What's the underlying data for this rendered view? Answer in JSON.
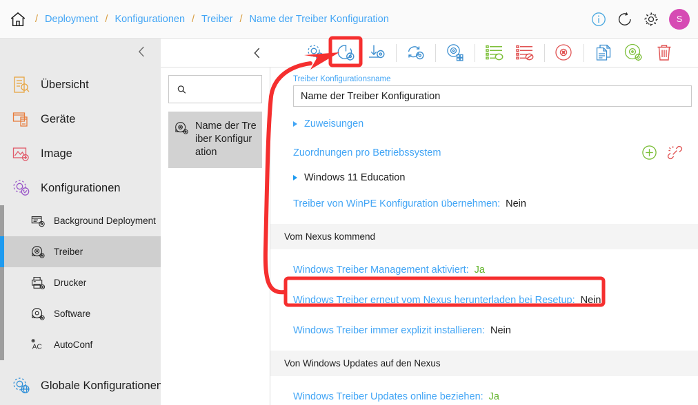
{
  "topbar": {
    "home_icon": "home-icon",
    "breadcrumbs": [
      {
        "label": "Deployment"
      },
      {
        "label": "Konfigurationen"
      },
      {
        "label": "Treiber"
      },
      {
        "label": "Name der Treiber Konfiguration"
      }
    ],
    "separator": "/",
    "actions": [
      {
        "name": "info-icon",
        "label": "i"
      },
      {
        "name": "refresh-icon",
        "label": ""
      },
      {
        "name": "gear-icon",
        "label": ""
      }
    ],
    "avatar_initial": "S",
    "avatar_color": "#d64bb4"
  },
  "sidebar": {
    "collapse_icon": "chevron-left-icon",
    "items": [
      {
        "label": "Übersicht",
        "icon": "overview-icon",
        "color": "#e8a33d"
      },
      {
        "label": "Geräte",
        "icon": "devices-icon",
        "color": "#e87d3d"
      },
      {
        "label": "Image",
        "icon": "image-icon",
        "color": "#e05a6a"
      },
      {
        "label": "Konfigurationen",
        "icon": "configurations-icon",
        "color": "#9a56c9"
      }
    ],
    "subitems": [
      {
        "label": "Background Deployment",
        "icon": "background-deployment-icon",
        "active": false
      },
      {
        "label": "Treiber",
        "icon": "driver-icon",
        "active": true
      },
      {
        "label": "Drucker",
        "icon": "printer-icon",
        "active": false
      },
      {
        "label": "Software",
        "icon": "software-icon",
        "active": false
      },
      {
        "label": "AutoConf",
        "icon": "autoconf-icon",
        "active": false
      }
    ],
    "global": {
      "label": "Globale Konfigurationen",
      "icon": "global-configurations-icon",
      "color": "#2e8fd8"
    }
  },
  "listpanel": {
    "search_placeholder": "",
    "search_value": "",
    "search_icon": "search-icon",
    "entry": {
      "label": "Name der Treiber Konfiguration",
      "icon": "driver-config-icon",
      "selected": true
    }
  },
  "toolbar": {
    "back_icon": "chevron-left-icon",
    "buttons": [
      {
        "name": "driver-settings-icon",
        "color": "#3d8fd0",
        "highlighted": false
      },
      {
        "name": "driver-redownload-icon",
        "color": "#3d8fd0",
        "highlighted": true
      },
      {
        "name": "driver-import-icon",
        "color": "#3d8fd0",
        "highlighted": false
      },
      {
        "name": "driver-sync-icon",
        "color": "#3d8fd0",
        "highlighted": false
      },
      {
        "name": "driver-assign-icon",
        "color": "#3d8fd0",
        "highlighted": false
      },
      {
        "name": "list-approve-icon",
        "color": "#7dbf3a",
        "highlighted": false
      },
      {
        "name": "list-reject-icon",
        "color": "#e05252",
        "highlighted": false
      },
      {
        "name": "disc-cancel-icon",
        "color": "#e05252",
        "highlighted": false
      },
      {
        "name": "copy-documents-icon",
        "color": "#3d8fd0",
        "highlighted": false
      },
      {
        "name": "driver-configure-icon",
        "color": "#7dbf3a",
        "highlighted": false
      },
      {
        "name": "delete-trash-icon",
        "color": "#e05252",
        "highlighted": false
      }
    ]
  },
  "main": {
    "name_field": {
      "label": "Treiber Konfigurationsname",
      "value": "Name der Treiber Konfiguration"
    },
    "assignments": {
      "label": "Zuweisungen"
    },
    "os_mappings": {
      "label": "Zuordnungen pro Betriebssystem",
      "add_icon": "add-circle-icon",
      "unlink_icon": "unlink-icon"
    },
    "os_entry": {
      "label": "Windows 11 Education"
    },
    "rows": [
      {
        "type": "prop",
        "key": "Treiber von WinPE Konfiguration übernehmen:",
        "value": "Nein",
        "value_state": "no"
      },
      {
        "type": "band",
        "label": "Vom Nexus kommend"
      },
      {
        "type": "prop",
        "key": "Windows Treiber Management aktiviert:",
        "value": "Ja",
        "value_state": "yes"
      },
      {
        "type": "prop",
        "key": "Windows Treiber erneut vom Nexus herunterladen bei Resetup:",
        "value": "Nein",
        "value_state": "no",
        "highlighted": true
      },
      {
        "type": "prop",
        "key": "Windows Treiber immer explizit installieren:",
        "value": "Nein",
        "value_state": "no"
      },
      {
        "type": "band",
        "label": "Von Windows Updates auf den Nexus"
      },
      {
        "type": "prop",
        "key": "Windows Treiber Updates online beziehen:",
        "value": "Ja",
        "value_state": "yes"
      }
    ]
  },
  "annotations": {
    "highlight_color": "#f52f2f",
    "arrow_icon": "annotation-arrow",
    "toolbar_highlight_box": "annotation-box-toolbar",
    "row_highlight_box": "annotation-box-row"
  }
}
